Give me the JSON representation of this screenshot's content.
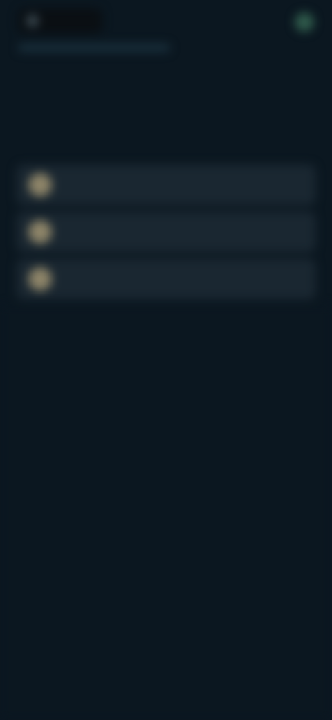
{
  "topbar": {
    "logo_text": "",
    "actions": [
      {
        "label": ""
      },
      {
        "label": ""
      }
    ],
    "profile_initial": ""
  },
  "title": "",
  "list": [
    {
      "label": ""
    },
    {
      "label": ""
    },
    {
      "label": ""
    }
  ],
  "colors": {
    "background": "#0b1720",
    "card": "#1a2731",
    "accent": "#2f5a4b",
    "avatar": "#8d8468"
  }
}
